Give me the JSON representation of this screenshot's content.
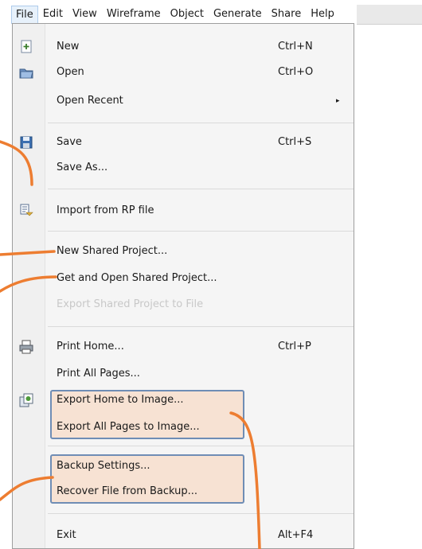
{
  "menubar": {
    "items": [
      {
        "label": "File"
      },
      {
        "label": "Edit"
      },
      {
        "label": "View"
      },
      {
        "label": "Wireframe"
      },
      {
        "label": "Object"
      },
      {
        "label": "Generate"
      },
      {
        "label": "Share"
      },
      {
        "label": "Help"
      }
    ]
  },
  "file_menu": {
    "new": {
      "label": "New",
      "shortcut": "Ctrl+N",
      "icon": "new-file-icon"
    },
    "open": {
      "label": "Open",
      "shortcut": "Ctrl+O",
      "icon": "open-folder-icon"
    },
    "open_recent": {
      "label": "Open Recent",
      "submenu_arrow": "▸"
    },
    "save": {
      "label": "Save",
      "shortcut": "Ctrl+S",
      "icon": "save-disk-icon"
    },
    "save_as": {
      "label": "Save As..."
    },
    "import_rp": {
      "label": "Import from RP file",
      "icon": "import-icon"
    },
    "new_shared": {
      "label": "New Shared Project..."
    },
    "get_open_shared": {
      "label": "Get and Open Shared Project..."
    },
    "export_shared": {
      "label": "Export Shared Project to File",
      "disabled": true
    },
    "print_home": {
      "label": "Print Home...",
      "shortcut": "Ctrl+P",
      "icon": "printer-icon"
    },
    "print_all": {
      "label": "Print All Pages..."
    },
    "export_home_image": {
      "label": "Export Home to Image...",
      "icon": "export-image-icon"
    },
    "export_all_image": {
      "label": "Export All Pages to Image..."
    },
    "backup_settings": {
      "label": "Backup Settings..."
    },
    "recover_backup": {
      "label": "Recover File from Backup..."
    },
    "exit": {
      "label": "Exit",
      "shortcut": "Alt+F4"
    }
  },
  "colors": {
    "callout_line": "#ed7d31",
    "highlight_fill": "#f7e2d3",
    "highlight_border": "#6f8db5",
    "active_menu_bg": "#e7f1fb"
  }
}
